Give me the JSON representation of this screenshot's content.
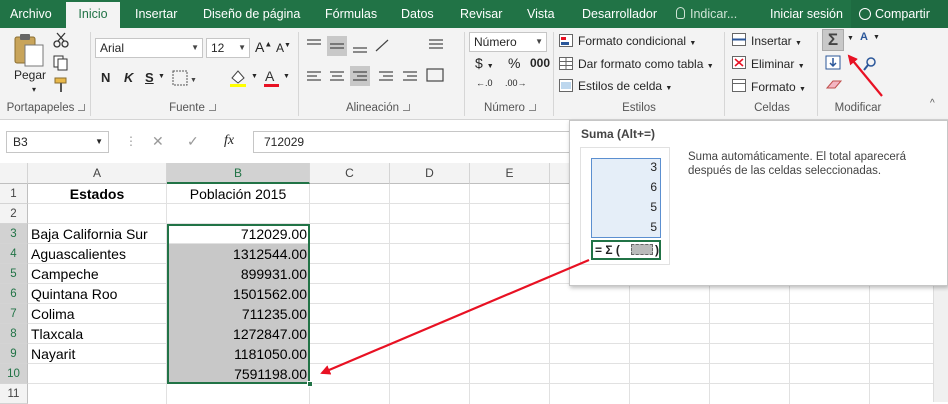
{
  "tabs": {
    "archivo": "Archivo",
    "inicio": "Inicio",
    "insertar": "Insertar",
    "diseno": "Diseño de página",
    "formulas": "Fórmulas",
    "datos": "Datos",
    "revisar": "Revisar",
    "vista": "Vista",
    "desarrollador": "Desarrollador",
    "indicar": "Indicar...",
    "iniciar_sesion": "Iniciar sesión",
    "compartir": "Compartir"
  },
  "ribbon": {
    "groups": {
      "portapapeles": "Portapapeles",
      "fuente": "Fuente",
      "alineacion": "Alineación",
      "numero": "Número",
      "estilos": "Estilos",
      "celdas": "Celdas",
      "modificar": "Modificar"
    },
    "pegar": "Pegar",
    "font_name": "Arial",
    "font_size": "12",
    "bold": "N",
    "italic": "K",
    "underline": "S",
    "number_format": "Número",
    "formato_condicional": "Formato condicional",
    "dar_formato_tabla": "Dar formato como tabla",
    "estilos_celda": "Estilos de celda",
    "insertar": "Insertar",
    "eliminar": "Eliminar",
    "formato": "Formato"
  },
  "formula_bar": {
    "name_box": "B3",
    "fx": "fx",
    "value": "712029"
  },
  "grid": {
    "columns": [
      "A",
      "B",
      "C",
      "D",
      "E"
    ],
    "rows": [
      "1",
      "2",
      "3",
      "4",
      "5",
      "6",
      "7",
      "8",
      "9",
      "10",
      "11"
    ],
    "header_a": "Estados",
    "header_b": "Población 2015",
    "states": [
      "Baja California Sur",
      "Aguascalientes",
      "Campeche",
      "Quintana Roo",
      "Colima",
      "Tlaxcala",
      "Nayarit"
    ],
    "values": [
      "712029.00",
      "1312544.00",
      "899931.00",
      "1501562.00",
      "711235.00",
      "1272847.00",
      "1181050.00"
    ],
    "total": "7591198.00"
  },
  "tooltip": {
    "title": "Suma (Alt+=)",
    "description_line1": "Suma automáticamente. El total aparecerá",
    "description_line2": "después de las celdas seleccionadas.",
    "example_values": [
      "3",
      "6",
      "5",
      "5"
    ],
    "example_formula": "= Σ ("
  },
  "colors": {
    "excel_green": "#217346",
    "selection_gray": "#c8c8c8",
    "arrow_red": "#e81123"
  }
}
